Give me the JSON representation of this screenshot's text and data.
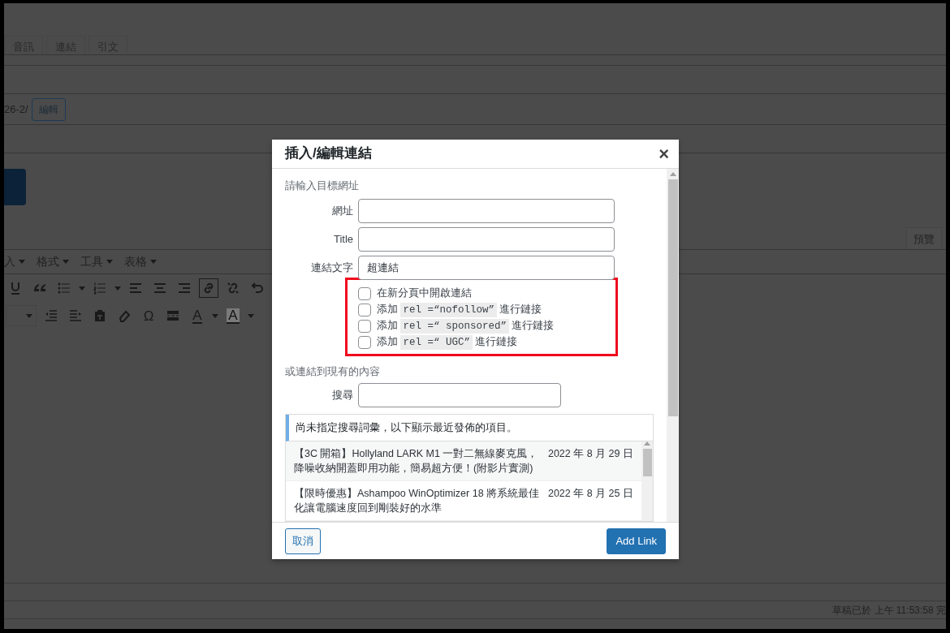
{
  "editor": {
    "tabs": [
      {
        "label": "音訊"
      },
      {
        "label": "連結"
      },
      {
        "label": "引文"
      }
    ],
    "permalink": "26-2/",
    "edit_button": "編輯",
    "preview_tab": "預覽",
    "menus": [
      "入",
      "格式",
      "工具",
      "表格"
    ],
    "toolbar_rows": [
      [
        {
          "kind": "underline",
          "active": false
        },
        {
          "kind": "blockquote",
          "active": false
        },
        {
          "kind": "bullet-list",
          "active": false
        },
        {
          "kind": "number-list",
          "active": false
        },
        {
          "kind": "align-left",
          "active": false
        },
        {
          "kind": "align-center",
          "active": false
        },
        {
          "kind": "align-right",
          "active": false
        },
        {
          "kind": "link",
          "active": true
        },
        {
          "kind": "unlink",
          "active": false
        },
        {
          "kind": "undo",
          "active": false
        }
      ],
      [
        {
          "kind": "select",
          "active": false
        },
        {
          "kind": "outdent",
          "active": false
        },
        {
          "kind": "indent",
          "active": false
        },
        {
          "kind": "paste",
          "active": false
        },
        {
          "kind": "eraser",
          "active": false
        },
        {
          "kind": "glyph",
          "glyph": "Ω",
          "active": false
        },
        {
          "kind": "more",
          "active": false
        },
        {
          "kind": "text-color",
          "glyph": "A",
          "active": false
        },
        {
          "kind": "background-color",
          "glyph": "A",
          "active": false
        }
      ]
    ],
    "status": "草稿已於 上午 11:53:58 完"
  },
  "dialog": {
    "title": "插入/編輯連結",
    "close": "×",
    "section_label": "請輸入目標網址",
    "fields": [
      {
        "label": "網址"
      },
      {
        "label": "Title"
      },
      {
        "label": "連結文字",
        "value": "超連結"
      }
    ],
    "options": [
      {
        "kind": "plain",
        "text": "在新分頁中開啟連結",
        "checked": false
      },
      {
        "kind": "code",
        "prefix": "添加",
        "code": "rel =“nofollow”",
        "suffix": "進行鏈接",
        "checked": false
      },
      {
        "kind": "code",
        "prefix": "添加",
        "code": "rel =“ sponsored”",
        "suffix": "進行鏈接",
        "checked": false
      },
      {
        "kind": "code",
        "prefix": "添加",
        "code": "rel =“ UGC”",
        "suffix": "進行鏈接",
        "checked": false
      }
    ],
    "existing_label": "或連結到現有的內容",
    "search": {
      "label": "搜尋"
    },
    "notice": "尚未指定搜尋詞彙，以下顯示最近發佈的項目。",
    "results": [
      {
        "title": "【3C 開箱】Hollyland LARK M1 一對二無線麥克風，降噪收納開蓋即用功能，簡易超方便！(附影片實測)",
        "date": "2022 年 8 月 29 日"
      },
      {
        "title": "【限時優惠】Ashampoo WinOptimizer 18 將系統最佳化讓電腦速度回到剛裝好的水準",
        "date": "2022 年 8 月 25 日"
      }
    ],
    "buttons": {
      "cancel": "取消",
      "submit": "Add Link"
    }
  }
}
